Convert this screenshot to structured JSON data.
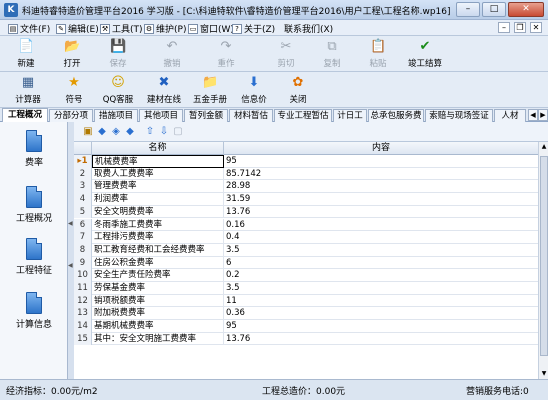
{
  "window": {
    "title": "科迪特睿特造价管理平台2016 学习版 - [C:\\科迪特软件\\睿特造价管理平台2016\\用户工程\\工程名称.wp16]",
    "app_icon": "K",
    "min": "–",
    "max": "□",
    "close": "✕"
  },
  "menu": [
    {
      "label": "文件(F)",
      "icon": "file-icon"
    },
    {
      "label": "编辑(E)",
      "icon": "edit-icon"
    },
    {
      "label": "工具(T)",
      "icon": "tools-icon"
    },
    {
      "label": "维护(P)",
      "icon": "maintain-icon"
    },
    {
      "label": "窗口(W)",
      "icon": "window-icon"
    },
    {
      "label": "关于(Z)",
      "icon": "about-icon"
    },
    {
      "label": "联系我们(X)",
      "icon": ""
    }
  ],
  "toolbar1": [
    {
      "label": "新建",
      "icon": "📄",
      "enabled": true
    },
    {
      "label": "打开",
      "icon": "📂",
      "enabled": true
    },
    {
      "label": "保存",
      "icon": "💾",
      "enabled": false
    },
    {
      "label": "撤销",
      "icon": "↶",
      "enabled": false
    },
    {
      "label": "重作",
      "icon": "↷",
      "enabled": false
    },
    {
      "label": "剪切",
      "icon": "✂",
      "enabled": false
    },
    {
      "label": "复制",
      "icon": "⧉",
      "enabled": false
    },
    {
      "label": "粘贴",
      "icon": "📋",
      "enabled": false
    },
    {
      "label": "竣工结算",
      "icon": "✔",
      "enabled": true
    }
  ],
  "toolbar2": [
    {
      "label": "计算器",
      "icon": "▦"
    },
    {
      "label": "符号",
      "icon": "★"
    },
    {
      "label": "QQ客服",
      "icon": "☺"
    },
    {
      "label": "建材在线",
      "icon": "✖"
    },
    {
      "label": "五金手册",
      "icon": "📁"
    },
    {
      "label": "信息价",
      "icon": "⬇"
    },
    {
      "label": "关闭",
      "icon": "✿"
    }
  ],
  "tabs": [
    "工程概况",
    "分部分项",
    "措施项目",
    "其他项目",
    "暂列金额",
    "材料暂估",
    "专业工程暂估",
    "计日工",
    "总承包服务费",
    "索赔与现场签证",
    "人材"
  ],
  "sidebar": [
    {
      "label": "费率"
    },
    {
      "label": "工程概况"
    },
    {
      "label": "工程特征"
    },
    {
      "label": "计算信息"
    }
  ],
  "grid": {
    "col_name": "名称",
    "col_content": "内容",
    "rows": [
      {
        "num": "1",
        "name": "机械费费率",
        "value": "95"
      },
      {
        "num": "2",
        "name": "取费人工费费率",
        "value": "85.7142"
      },
      {
        "num": "3",
        "name": "管理费费率",
        "value": "28.98"
      },
      {
        "num": "4",
        "name": "利润费率",
        "value": "31.59"
      },
      {
        "num": "5",
        "name": "安全文明费费率",
        "value": "13.76"
      },
      {
        "num": "6",
        "name": "冬雨季施工费费率",
        "value": "0.16"
      },
      {
        "num": "7",
        "name": "工程排污费费率",
        "value": "0.4"
      },
      {
        "num": "8",
        "name": "职工教育经费和工会经费费率",
        "value": "3.5"
      },
      {
        "num": "9",
        "name": "住房公积金费率",
        "value": "6"
      },
      {
        "num": "10",
        "name": "安全生产责任险费率",
        "value": "0.2"
      },
      {
        "num": "11",
        "name": "劳保基金费率",
        "value": "3.5"
      },
      {
        "num": "12",
        "name": "销项税额费率",
        "value": "11"
      },
      {
        "num": "13",
        "name": "附加税费费率",
        "value": "0.36"
      },
      {
        "num": "14",
        "name": "基期机械费费率",
        "value": "95"
      },
      {
        "num": "15",
        "name": "其中：安全文明施工费费率",
        "value": "13.76"
      }
    ]
  },
  "status": {
    "econ": "经济指标：0.00元/m2",
    "total": "工程总造价：0.00元",
    "hotline": "营销服务电话:0"
  }
}
